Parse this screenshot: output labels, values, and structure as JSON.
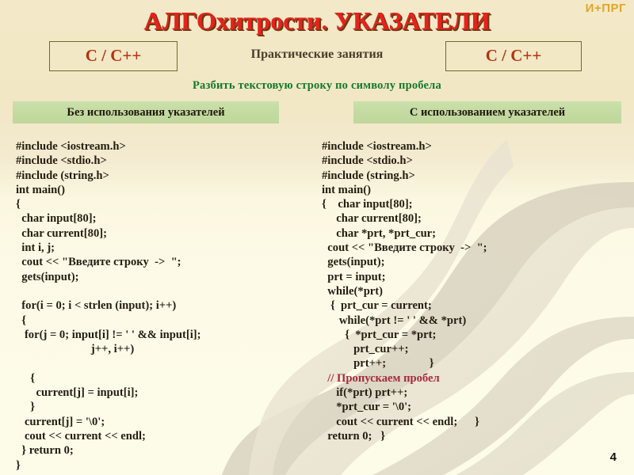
{
  "header": {
    "logo": "И+ПРГ",
    "title": "АЛГОхитрости. УКАЗАТЕЛИ",
    "lang_badge_left": "C / C++",
    "lang_badge_right": "C / C++",
    "center_label": "Практические занятия",
    "subtitle": "Разбить текстовую строку по символу пробела"
  },
  "columns": {
    "left": {
      "heading": "Без использования указателей",
      "code_lines": [
        "#include <iostream.h>",
        "#include <stdio.h>",
        "#include (string.h>",
        "int main()",
        "{",
        "  char input[80];",
        "  char current[80];",
        "  int i, j;",
        "  cout << \"Введите строку  ->  \";",
        "  gets(input);",
        "",
        "  for(i = 0; i < strlen (input); i++)",
        "  {",
        "   for(j = 0; input[i] != ' ' && input[i];",
        "                          j++, i++)",
        "",
        "     {",
        "       current[j] = input[i];",
        "     }",
        "   current[j] = '\\0';",
        "   cout << current << endl;",
        "  } return 0;",
        "}"
      ]
    },
    "right": {
      "heading": "С  использованием указателей",
      "code_lines": [
        "#include <iostream.h>",
        "#include <stdio.h>",
        "#include (string.h>",
        "int main()",
        "{    char input[80];",
        "     char current[80];",
        "     char *prt, *prt_cur;",
        "  cout << \"Введите строку  ->  \";",
        "  gets(input);",
        "  prt = input;",
        "  while(*prt)",
        "   {  prt_cur = current;",
        "      while(*prt != ' ' && *prt)",
        "        {  *prt_cur = *prt;",
        "           prt_cur++;",
        "           prt++;               }",
        "  // Пропускаем пробел",
        "     if(*prt) prt++;",
        "     *prt_cur = '\\0';",
        "     cout << current << endl;      }",
        "  return 0;   }"
      ],
      "comment_line_index": 16
    }
  },
  "footer": {
    "page_number": "4"
  },
  "colors": {
    "title_red": "#e8211c",
    "title_shadow": "#6a3a14",
    "logo_gold": "#e3a427",
    "badge_text": "#b63310",
    "badge_border": "#6e6a2d",
    "subtitle_green": "#127a2a",
    "greenbar_bg": "#c3daa1",
    "code_text": "#241d10",
    "comment_red": "#a62a3c",
    "background_top": "#f2e7c4",
    "background_bottom": "#fdfce9"
  }
}
